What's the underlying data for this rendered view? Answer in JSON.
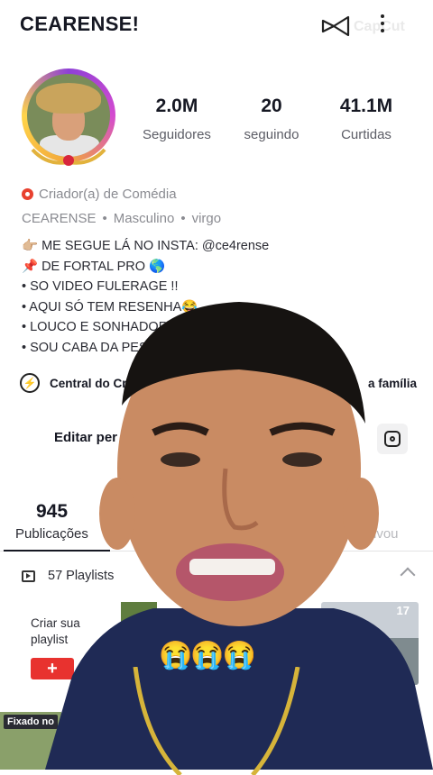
{
  "header": {
    "username": "CEARENSE!",
    "watermark": "CapCut",
    "capcut_icon": "capcut-logo-icon",
    "menu_icon": "more-vert-icon"
  },
  "stats": [
    {
      "value": "2.0M",
      "label": "Seguidores"
    },
    {
      "value": "20",
      "label": "seguindo"
    },
    {
      "value": "41.1M",
      "label": "Curtidas"
    }
  ],
  "profile": {
    "category": "Criador(a) de Comédia",
    "meta": [
      "CEARENSE",
      "Masculino",
      "virgo"
    ],
    "bio": [
      "👉🏼 ME SEGUE LÁ NO INSTA: @ce4rense",
      "📌 DE FORTAL PRO 🌎",
      "• SO VIDEO FULERAGE !!",
      "• AQUI SÓ TEM RESENHA😂",
      "• LOUCO E SONHADOR",
      "• SOU CABA DA PES"
    ]
  },
  "creator_center": {
    "label": "Central do Cria",
    "family_label": "a família"
  },
  "actions": {
    "edit_label": "Editar per"
  },
  "tabs": {
    "posts_count": "945",
    "posts_label": "Publicações",
    "liked_label": "ivou"
  },
  "playlists": {
    "label": "57 Playlists",
    "create_label_1": "Criar sua",
    "create_label_2": "playlist",
    "add_symbol": "+",
    "thumb_count": "17"
  },
  "pinned": {
    "label": "Fixado no"
  },
  "overlay": {
    "emojis": "😭😭😭"
  },
  "colors": {
    "accent_red": "#e8322f",
    "category_dot": "#e8412f"
  }
}
